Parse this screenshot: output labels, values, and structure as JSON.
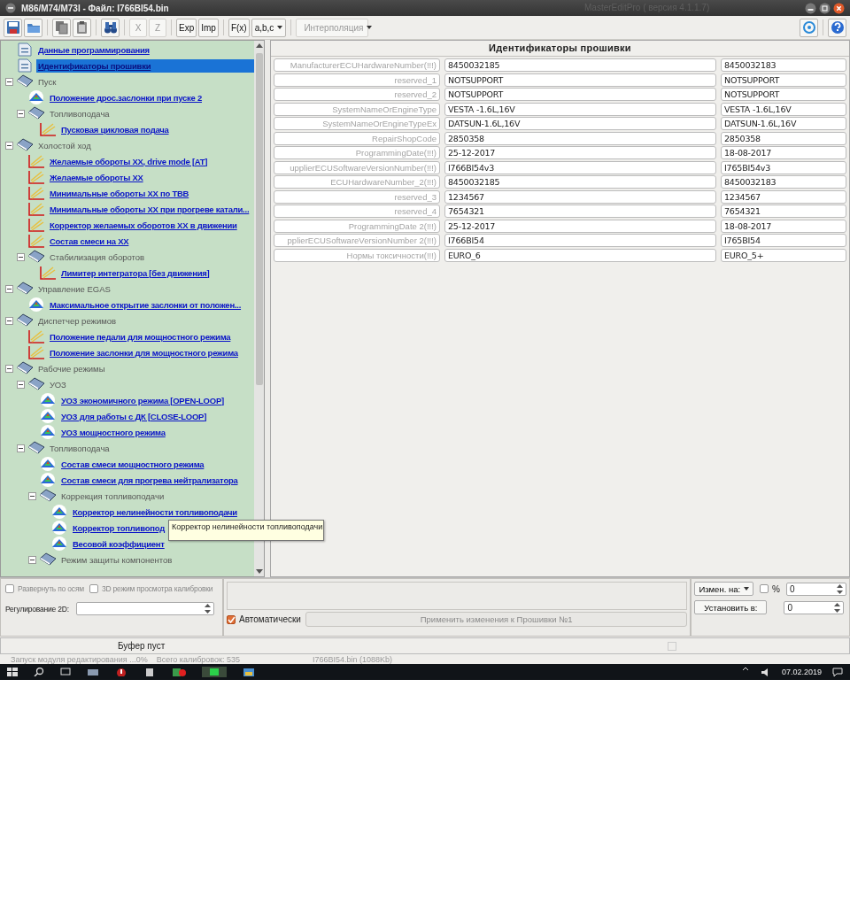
{
  "window": {
    "title": "M86/M74/M73I - Файл: I766BI54.bin",
    "app_title": "MasterEditPro ( версия 4.1.1.7)"
  },
  "toolbar": [
    {
      "kind": "save"
    },
    {
      "kind": "open"
    },
    {
      "kind": "separator"
    },
    {
      "kind": "copy"
    },
    {
      "kind": "paste"
    },
    {
      "kind": "separator"
    },
    {
      "kind": "find"
    },
    {
      "kind": "separator"
    },
    {
      "kind": "text",
      "label": "X",
      "disabled": true
    },
    {
      "kind": "text",
      "label": "Z",
      "disabled": true
    },
    {
      "kind": "separator"
    },
    {
      "kind": "text",
      "label": "Exp",
      "disabled": false
    },
    {
      "kind": "text",
      "label": "Imp",
      "disabled": false
    },
    {
      "kind": "separator"
    },
    {
      "kind": "text",
      "label": "F(x)",
      "disabled": false
    },
    {
      "kind": "dropdown",
      "label": "a,b,c",
      "disabled": false
    },
    {
      "kind": "separator"
    },
    {
      "kind": "dropdown",
      "label": "Интерполяция",
      "disabled": true
    },
    {
      "kind": "spacer"
    },
    {
      "kind": "refresh"
    },
    {
      "kind": "separator"
    },
    {
      "kind": "help"
    }
  ],
  "tree": [
    {
      "label": "Данные программирования",
      "kind": "text",
      "selected": false
    },
    {
      "label": "Идентификаторы прошивки",
      "kind": "text",
      "selected": true
    },
    {
      "label": "Пуск",
      "kind": "group",
      "expanded": true,
      "children": [
        {
          "label": "Положение дрос.заслонки при пуске 2",
          "kind": "map",
          "selected": false
        },
        {
          "label": "Топливоподача",
          "kind": "group",
          "expanded": true,
          "children": [
            {
              "label": "Пусковая цикловая подача",
              "kind": "curve",
              "selected": false
            }
          ]
        }
      ]
    },
    {
      "label": "Холостой ход",
      "kind": "group",
      "expanded": true,
      "children": [
        {
          "label": "Желаемые обороты ХХ, drive mode [AT]",
          "kind": "curve",
          "selected": false
        },
        {
          "label": "Желаемые обороты ХХ",
          "kind": "curve",
          "selected": false
        },
        {
          "label": "Минимальные обороты ХХ по ТВВ",
          "kind": "curve",
          "selected": false
        },
        {
          "label": "Минимальные обороты ХХ при прогреве катали...",
          "kind": "curve",
          "selected": false
        },
        {
          "label": "Корректор желаемых оборотов ХХ в движении",
          "kind": "curve",
          "selected": false
        },
        {
          "label": "Состав смеси на ХХ",
          "kind": "curve",
          "selected": false
        },
        {
          "label": "Стабилизация оборотов",
          "kind": "group",
          "expanded": true,
          "children": [
            {
              "label": "Лимитер интегратора [без движения]",
              "kind": "curve",
              "selected": false
            }
          ]
        }
      ]
    },
    {
      "label": "Управление EGAS",
      "kind": "group",
      "expanded": true,
      "children": [
        {
          "label": "Максимальное открытие заслонки от положен...",
          "kind": "map",
          "selected": false
        }
      ]
    },
    {
      "label": "Диспетчер режимов",
      "kind": "group",
      "expanded": true,
      "children": [
        {
          "label": "Положение педали для мощностного режима",
          "kind": "curve",
          "selected": false
        },
        {
          "label": "Положение заслонки для мощностного режима",
          "kind": "curve",
          "selected": false
        }
      ]
    },
    {
      "label": "Рабочие режимы",
      "kind": "group",
      "expanded": true,
      "children": [
        {
          "label": "УОЗ",
          "kind": "group",
          "expanded": true,
          "children": [
            {
              "label": "УОЗ экономичного режима [OPEN-LOOP]",
              "kind": "map",
              "selected": false
            },
            {
              "label": "УОЗ для работы с ДК [CLOSE-LOOP]",
              "kind": "map",
              "selected": false
            },
            {
              "label": "УОЗ мощностного режима",
              "kind": "map",
              "selected": false
            }
          ]
        },
        {
          "label": "Топливоподача",
          "kind": "group",
          "expanded": true,
          "children": [
            {
              "label": "Состав смеси мощностного режима",
              "kind": "map",
              "selected": false
            },
            {
              "label": "Состав смеси для прогрева нейтрализатора",
              "kind": "map",
              "selected": false
            },
            {
              "label": "Коррекция топливоподачи",
              "kind": "group",
              "expanded": true,
              "children": [
                {
                  "label": "Корректор нелинейности топливоподачи",
                  "kind": "map",
                  "selected": false
                },
                {
                  "label": "Корректор топливопод",
                  "kind": "map",
                  "selected": false
                },
                {
                  "label": "Весовой коэффициент",
                  "kind": "map",
                  "selected": false
                }
              ]
            },
            {
              "label": "Режим защиты компонентов",
              "kind": "group",
              "expanded": true
            }
          ]
        }
      ]
    }
  ],
  "tooltip": {
    "text": "Корректор нелинейности топливоподачи"
  },
  "panel": {
    "title": "Идентификаторы прошивки",
    "rows": [
      {
        "label": "ManufacturerECUHardwareNumber(!!!)",
        "value_1": "8450032185",
        "value_2": "8450032183"
      },
      {
        "label": "reserved_1",
        "value_1": "NOTSUPPORT",
        "value_2": "NOTSUPPORT"
      },
      {
        "label": "reserved_2",
        "value_1": "NOTSUPPORT",
        "value_2": "NOTSUPPORT"
      },
      {
        "label": "SystemNameOrEngineType",
        "value_1": "VESTA -1.6L,16V",
        "value_2": "VESTA -1.6L,16V"
      },
      {
        "label": "SystemNameOrEngineTypeEx",
        "value_1": "DATSUN-1.6L,16V",
        "value_2": "DATSUN-1.6L,16V"
      },
      {
        "label": "RepairShopCode",
        "value_1": "2850358",
        "value_2": "2850358"
      },
      {
        "label": "ProgrammingDate(!!!)",
        "value_1": "25-12-2017",
        "value_2": "18-08-2017"
      },
      {
        "label": "upplierECUSoftwareVersionNumber(!!!)",
        "value_1": "I766BI54v3",
        "value_2": "I765BI54v3"
      },
      {
        "label": "ECUHardwareNumber_2(!!!)",
        "value_1": "8450032185",
        "value_2": "8450032183"
      },
      {
        "label": "reserved_3",
        "value_1": "1234567",
        "value_2": "1234567"
      },
      {
        "label": "reserved_4",
        "value_1": "7654321",
        "value_2": "7654321"
      },
      {
        "label": "ProgrammingDate 2(!!!)",
        "value_1": "25-12-2017",
        "value_2": "18-08-2017"
      },
      {
        "label": "pplierECUSoftwareVersionNumber 2(!!!)",
        "value_1": "I766BI54",
        "value_2": "I765BI54"
      },
      {
        "label": "Нормы токсичности(!!!)",
        "value_1": "EURO_6",
        "value_2": "EURO_5+"
      }
    ]
  },
  "bottom": {
    "expand_axes": {
      "label": "Развернуть по осям",
      "checked": false
    },
    "view_3d": {
      "label": "3D режим просмотра калибровки",
      "checked": false
    },
    "regulation_label": "Регулирование 2D:",
    "auto": {
      "label": "Автоматически",
      "checked": true
    },
    "apply_button": {
      "label": "Применить изменения к Прошивки №1",
      "disabled": true
    },
    "change_dropdown": "Измен. на:",
    "percent": {
      "label": "%",
      "checked": false
    },
    "change_value": "0",
    "set_button": "Установить в:",
    "set_value": "0"
  },
  "status": {
    "buffer": "Буфер пуст",
    "messages": [
      "Запуск модуля редактирования ...0%",
      "Всего калибровок: 535",
      "I766BI54.bin (1088Kb)"
    ]
  },
  "taskbar": {
    "date": "07.02.2019"
  }
}
